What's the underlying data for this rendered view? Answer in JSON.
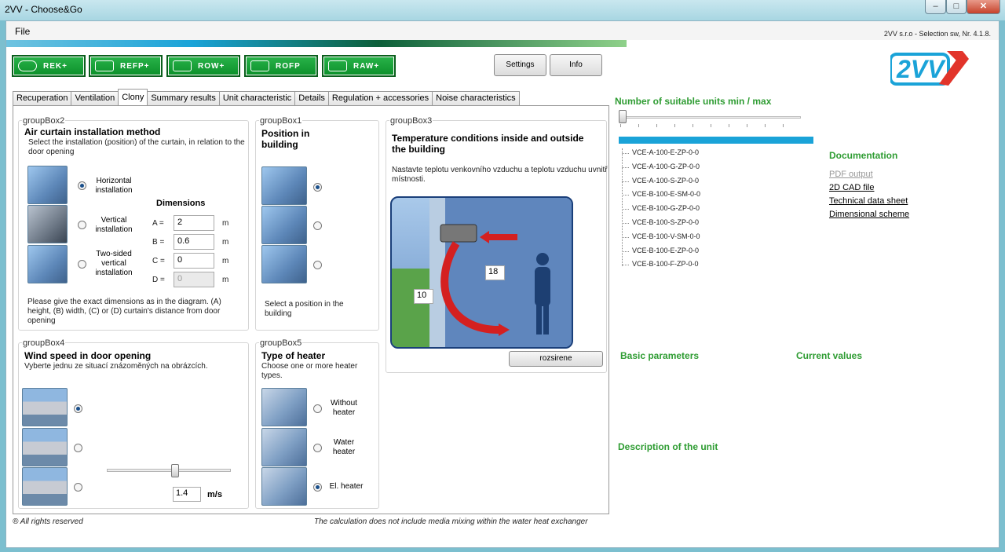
{
  "window": {
    "title": "2VV - Choose&Go",
    "version": "2VV s.r.o - Selection sw, Nr. 4.1.8."
  },
  "menu": {
    "file": "File"
  },
  "modules": [
    {
      "label": "REK+"
    },
    {
      "label": "REFP+"
    },
    {
      "label": "ROW+"
    },
    {
      "label": "ROFP"
    },
    {
      "label": "RAW+"
    }
  ],
  "toolbar": {
    "settings": "Settings",
    "info": "Info"
  },
  "logo": {
    "text": "2VV"
  },
  "tabs": [
    "Recuperation",
    "Ventilation",
    "Clony",
    "Summary results",
    "Unit characteristic",
    "Details",
    "Regulation + accessories",
    "Noise characteristics"
  ],
  "groupBox2": {
    "caption": "groupBox2",
    "title": "Air curtain installation method",
    "desc": "Select the installation (position) of the curtain, in relation to the door opening",
    "options": [
      "Horizontal installation",
      "Vertical installation",
      "Two-sided vertical installation"
    ],
    "dims_title": "Dimensions",
    "dims": [
      {
        "name": "A =",
        "value": "2",
        "unit": "m"
      },
      {
        "name": "B =",
        "value": "0.6",
        "unit": "m"
      },
      {
        "name": "C =",
        "value": "0",
        "unit": "m"
      },
      {
        "name": "D =",
        "value": "0",
        "unit": "m"
      }
    ],
    "note": "Please give the exact dimensions as in the diagram. (A) height, (B) width, (C) or (D) curtain's distance from door opening"
  },
  "groupBox1": {
    "caption": "groupBox1",
    "title": "Position in building",
    "note": "Select a position in the building"
  },
  "groupBox3": {
    "caption": "groupBox3",
    "title": "Temperature conditions inside and outside the building",
    "desc": "Nastavte teplotu venkovního vzduchu a teplotu vzduchu uvnitř místnosti.",
    "inside": "18",
    "outside": "10",
    "button": "rozsirene"
  },
  "groupBox4": {
    "caption": "groupBox4",
    "title": "Wind speed in door opening",
    "desc": "Vyberte jednu ze situací znázoměných na obrázcích.",
    "speed": "1.4",
    "unit": "m/s",
    "slider_level": 0.55
  },
  "groupBox5": {
    "caption": "groupBox5",
    "title": "Type of heater",
    "desc": "Choose one or more heater types.",
    "options": [
      "Without heater",
      "Water heater",
      "El. heater"
    ]
  },
  "right": {
    "units_title": "Number of suitable units min / max",
    "units": [
      "VCE-A-100-E-ZP-0-0",
      "VCE-A-100-G-ZP-0-0",
      "VCE-A-100-S-ZP-0-0",
      "VCE-B-100-E-SM-0-0",
      "VCE-B-100-G-ZP-0-0",
      "VCE-B-100-S-ZP-0-0",
      "VCE-B-100-V-SM-0-0",
      "VCE-B-100-E-ZP-0-0",
      "VCE-B-100-F-ZP-0-0"
    ],
    "documentation": "Documentation",
    "pdf": "PDF output",
    "cad": "2D CAD file",
    "tds": "Technical data sheet",
    "dim": "Dimensional scheme",
    "basic": "Basic parameters",
    "current": "Current values",
    "description": "Description of the unit"
  },
  "footer": {
    "rights": "® All rights reserved",
    "note": "The calculation does not include media mixing within the water heat exchanger"
  },
  "colors": {
    "accent": "#1aa3d8",
    "green": "#2e9c32",
    "module": "#14a03a"
  }
}
